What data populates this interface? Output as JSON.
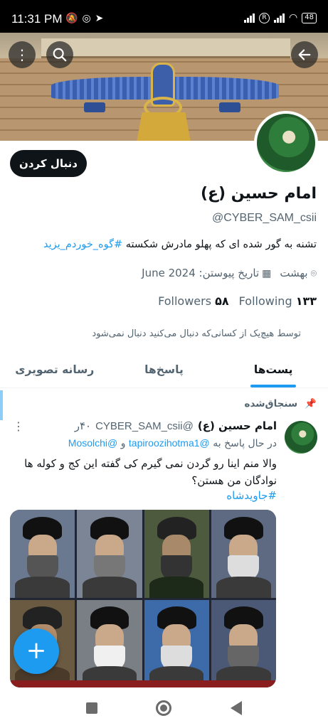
{
  "status_bar": {
    "time": "11:31 PM",
    "left_icons": [
      "mute-icon",
      "whatsapp-icon",
      "telegram-icon"
    ],
    "battery": "48"
  },
  "colors": {
    "accent": "#1d9bf0",
    "text": "#0f1419",
    "muted": "#536471"
  },
  "header": {
    "back_icon": "arrow-left-icon",
    "search_icon": "search-icon",
    "more_icon": "more-vertical-icon"
  },
  "profile": {
    "follow_label": "دنبال کردن",
    "name": "امام حسین (ع)",
    "handle": "@CYBER_SAM_csii",
    "bio_text": "تشنه به گور شده ای که پهلو مادرش شکسته ",
    "bio_hashtag": "#گوه_خوردم_یزید",
    "location": "بهشت",
    "joined": "تاریخ پیوستن: June 2024",
    "followers_count": "۵۸",
    "followers_label": "Followers",
    "following_count": "۱۳۳",
    "following_label": "Following",
    "not_followed": "توسط هیچ‌یک از کسانی‌که دنبال می‌کنید دنبال نمی‌شود"
  },
  "tabs": [
    {
      "label": "پست‌ها",
      "active": true
    },
    {
      "label": "پاسخ‌ها",
      "active": false
    },
    {
      "label": "رسانه تصویری",
      "active": false
    }
  ],
  "tweet": {
    "pinned_label": "سنجاق‌شده",
    "author_name": "امام حسین (ع)",
    "author_handle": "@CYBER_SAM_csii",
    "time": "۴۰ر",
    "reply_prefix": "در حال پاسخ به",
    "reply_mention_1": "@tapiroozihotma1",
    "reply_and": "و",
    "reply_mention_2": "@Mosolchi",
    "text": "والا منم اینا رو گردن نمی گیرم کی گفته این کج و کوله ها نوادگان من هستن؟",
    "hashtag": "#جاویدشاه"
  },
  "compose_icon": "plus-icon"
}
